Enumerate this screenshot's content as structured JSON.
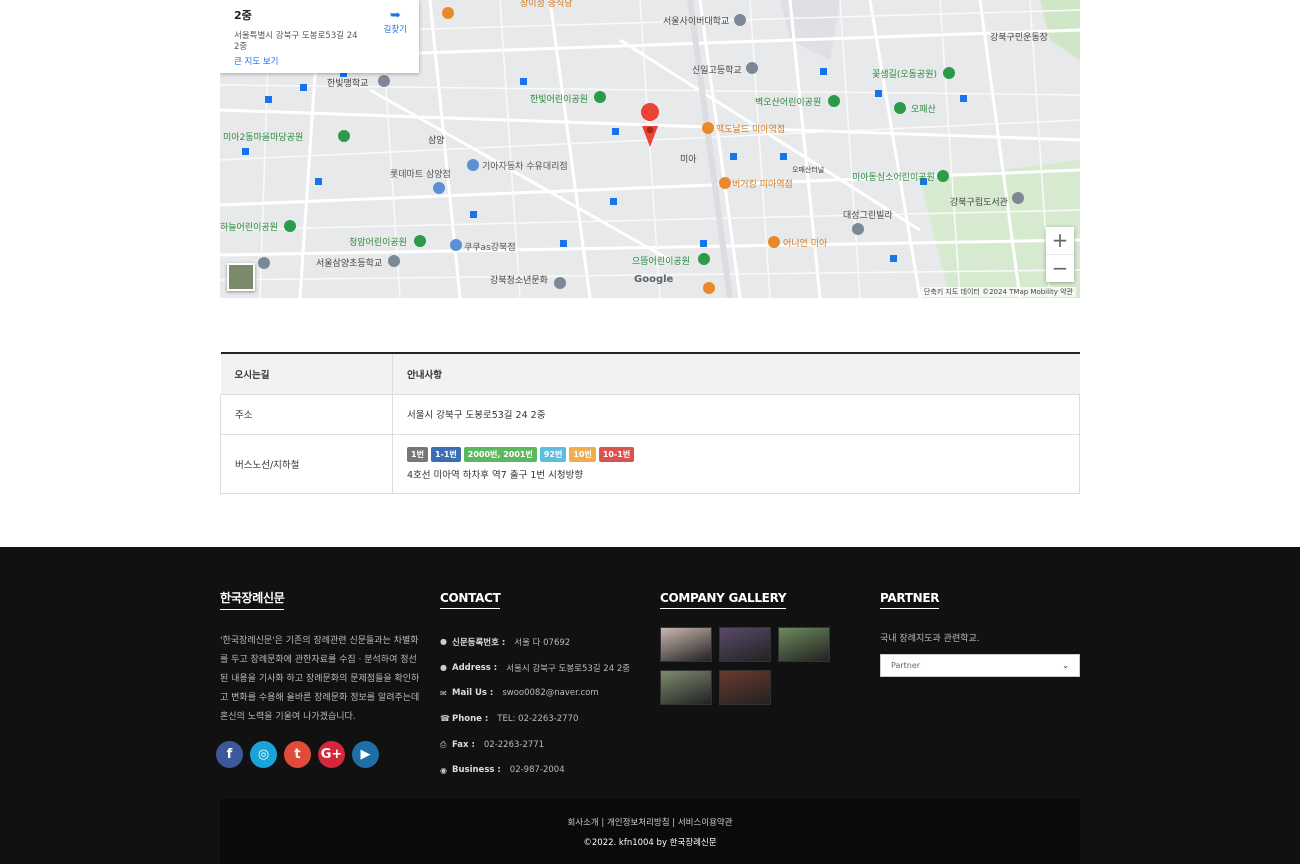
{
  "map": {
    "place": "2중",
    "address": "서울특별시 강북구 도봉로53길 24 2중",
    "directions": "길찾기",
    "big_map": "큰 지도 보기",
    "zoom_in": "+",
    "zoom_out": "−",
    "footer": "단축키   지도 데이터 ©2024 TMap Mobility   약관",
    "google": "Google",
    "labels": [
      "창이정 중식당",
      "서울사이버대학교",
      "강북구민운동장",
      "한빛맹학교",
      "신일고등학교",
      "꽃샘길(오동공원)",
      "벽오산어린이공원",
      "오패산",
      "미아2동마을마당공원",
      "한빛어린이공원",
      "맥도날드 미아역점",
      "기아자동차 수유대리점",
      "롯데마트 삼양점",
      "삼양",
      "미아",
      "버거킹 미아역점",
      "미아동심소어린이공원",
      "강북구립도서관",
      "대성그린빌라",
      "하늘어린이공원",
      "청암어린이공원",
      "쿠쿠as강북점",
      "서울삼양초등학교",
      "으뜸어린이공원",
      "어니언 미아",
      "강북청소년문화정보도서관",
      "오패산터널"
    ]
  },
  "info_table": {
    "headers": [
      "오시는길",
      "안내사항"
    ],
    "rows": [
      {
        "label": "주소",
        "value": "서울시 강북구 도봉로53길 24 2중"
      },
      {
        "label": "버스노선/지하철",
        "value": "4호선 미아역 하차후 역7 출구 1번 시청방향"
      }
    ],
    "bus_badges": [
      {
        "text": "1번",
        "color": "#777777"
      },
      {
        "text": "1-1번",
        "color": "#3a6fb5"
      },
      {
        "text": "2000번, 2001번",
        "color": "#5cb85c"
      },
      {
        "text": "92번",
        "color": "#5bc0de"
      },
      {
        "text": "10번",
        "color": "#f0ad4e"
      },
      {
        "text": "10-1번",
        "color": "#d9534f"
      }
    ]
  },
  "footer": {
    "about_title": "한국장례신문",
    "about_text": "'한국장례신문'은 기존의 장례관련 신문들과는 차별화를 두고 장례문화에 관한자료를 수집 · 분석하여 정선된 내용을 기사화 하고 장례문화의 문제점들을 확인하고 변화를 수용해 올바른 장례문화 정보를 알려주는데 혼신의 노력을 기울여 나가겠습니다.",
    "social": [
      {
        "name": "facebook-icon",
        "glyph": "f",
        "color": "#3b5998"
      },
      {
        "name": "instagram-icon",
        "glyph": "◎",
        "color": "#1aa3d8"
      },
      {
        "name": "twitter-icon",
        "glyph": "t",
        "color": "#e04b3a"
      },
      {
        "name": "google-plus-icon",
        "glyph": "G+",
        "color": "#d6273a"
      },
      {
        "name": "youtube-icon",
        "glyph": "▶",
        "color": "#1e6ea7"
      }
    ],
    "contact_title": "CONTACT",
    "contact": [
      {
        "icon": "●",
        "label": "신문등록번호 :",
        "value": "서울 다 07692"
      },
      {
        "icon": "●",
        "label": "Address :",
        "value": "서울시 강북구 도봉로53길 24 2중"
      },
      {
        "icon": "✉",
        "label": "Mail Us :",
        "value": "swoo0082@naver.com"
      },
      {
        "icon": "☎",
        "label": "Phone :",
        "value": "TEL: 02-2263-2770"
      },
      {
        "icon": "⎙",
        "label": "Fax :",
        "value": "02-2263-2771"
      },
      {
        "icon": "◉",
        "label": "Business :",
        "value": "02-987-2004"
      }
    ],
    "gallery_title": "COMPANY GALLERY",
    "gallery_colors": [
      "#c9b7b0",
      "#5a4a68",
      "#6d8a5c",
      "#7e8a70",
      "#6a3a2e"
    ],
    "partner_title": "PARTNER",
    "partner_text": "국내 장례지도과 관련학교.",
    "partner_select": "Partner",
    "bottom_links": "회사소개 | 개인정보처리방침 | 서비스이용약관",
    "copyright": "©2022. kfn1004 by 한국장례신문"
  }
}
